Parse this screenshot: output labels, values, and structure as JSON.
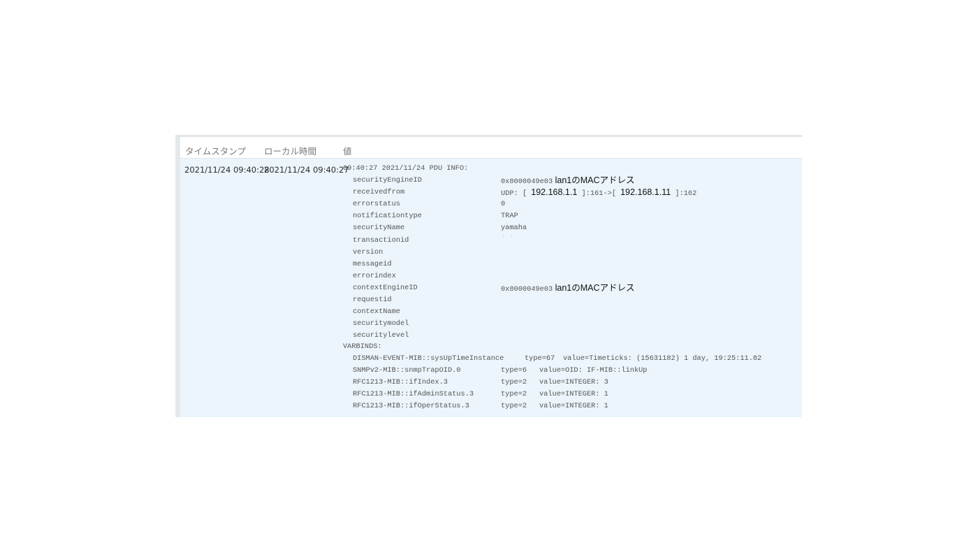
{
  "table": {
    "headers": {
      "timestamp": "タイムスタンプ",
      "local_time": "ローカル時間",
      "value": "値"
    },
    "row": {
      "timestamp": "2021/11/24 09:40:28",
      "local_time": "2021/11/24 09:40:27",
      "value_header": "09:40:27 2021/11/24 PDU INFO:",
      "pdu_fields": [
        {
          "name": "securityEngineID",
          "value": "0x8000049e03",
          "annotation": "lan1のMACアドレス"
        },
        {
          "name": "receivedfrom",
          "value": ""
        },
        {
          "name": "errorstatus",
          "value": "0"
        },
        {
          "name": "notificationtype",
          "value": "TRAP"
        },
        {
          "name": "securityName",
          "value": "yamaha"
        },
        {
          "name": "transactionid",
          "value": ""
        },
        {
          "name": "version",
          "value": ""
        },
        {
          "name": "messageid",
          "value": ""
        },
        {
          "name": "errorindex",
          "value": ""
        },
        {
          "name": "contextEngineID",
          "value": "0x8000049e03",
          "annotation": "lan1のMACアドレス"
        },
        {
          "name": "requestid",
          "value": ""
        },
        {
          "name": "contextName",
          "value": ""
        },
        {
          "name": "securitymodel",
          "value": ""
        },
        {
          "name": "securitylevel",
          "value": ""
        }
      ],
      "receivedfrom": {
        "prefix": "UDP: [",
        "src_ip": "192.168.1.1",
        "middle": "]:161->[",
        "dst_ip": "192.168.1.11",
        "suffix": "]:162"
      },
      "transactionid_mask": "‘ ‘",
      "varbinds_label": "VARBINDS:",
      "varbinds": [
        {
          "oid": "DISMAN-EVENT-MIB::sysUpTimeInstance",
          "type": "type=67",
          "value": "value=Timeticks: (15631182) 1 day, 19:25:11.82"
        },
        {
          "oid": "SNMPv2-MIB::snmpTrapOID.0",
          "type": "type=6",
          "value": "value=OID: IF-MIB::linkUp"
        },
        {
          "oid": "RFC1213-MIB::ifIndex.3",
          "type": "type=2",
          "value": "value=INTEGER: 3"
        },
        {
          "oid": "RFC1213-MIB::ifAdminStatus.3",
          "type": "type=2",
          "value": "value=INTEGER: 1"
        },
        {
          "oid": "RFC1213-MIB::ifOperStatus.3",
          "type": "type=2",
          "value": "value=INTEGER: 1"
        }
      ]
    }
  }
}
